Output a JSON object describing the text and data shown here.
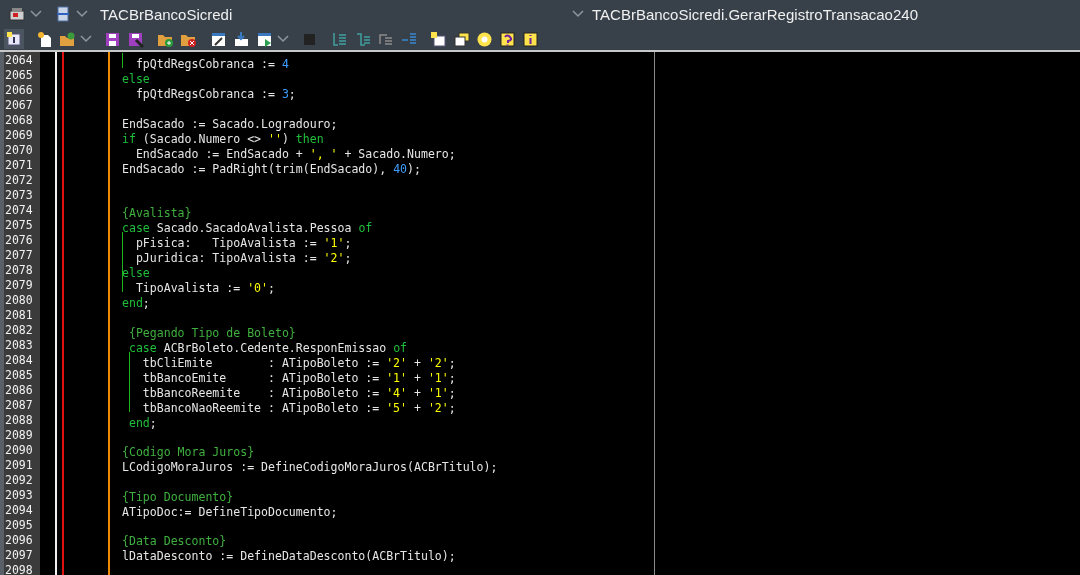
{
  "title_bar": {
    "class_name": "TACBrBancoSicredi",
    "method_name": "TACBrBancoSicredi.GerarRegistroTransacao240"
  },
  "editor": {
    "lines": [
      {
        "number": "2064",
        "guide": true,
        "tokens": [
          {
            "kind": "plain",
            "text": "  fpQtdRegsCobranca := "
          },
          {
            "kind": "number",
            "text": "4"
          }
        ]
      },
      {
        "number": "2065",
        "guide": false,
        "tokens": [
          {
            "kind": "keyword",
            "text": "else"
          }
        ]
      },
      {
        "number": "2066",
        "guide": false,
        "tokens": [
          {
            "kind": "plain",
            "text": "  fpQtdRegsCobranca := "
          },
          {
            "kind": "number",
            "text": "3"
          },
          {
            "kind": "plain",
            "text": ";"
          }
        ]
      },
      {
        "number": "2067",
        "guide": false
      },
      {
        "number": "2068",
        "guide": false,
        "tokens": [
          {
            "kind": "plain",
            "text": "EndSacado := Sacado.Logradouro;"
          }
        ]
      },
      {
        "number": "2069",
        "guide": false,
        "tokens": [
          {
            "kind": "keyword",
            "text": "if"
          },
          {
            "kind": "plain",
            "text": " (Sacado.Numero <> "
          },
          {
            "kind": "string",
            "text": "''"
          },
          {
            "kind": "plain",
            "text": ") "
          },
          {
            "kind": "keyword",
            "text": "then"
          }
        ]
      },
      {
        "number": "2070",
        "guide": false,
        "tokens": [
          {
            "kind": "plain",
            "text": "  EndSacado := EndSacado + "
          },
          {
            "kind": "string",
            "text": "', '"
          },
          {
            "kind": "plain",
            "text": " + Sacado.Numero;"
          }
        ]
      },
      {
        "number": "2071",
        "guide": false,
        "tokens": [
          {
            "kind": "plain",
            "text": "EndSacado := PadRight(trim(EndSacado), "
          },
          {
            "kind": "number",
            "text": "40"
          },
          {
            "kind": "plain",
            "text": ");"
          }
        ]
      },
      {
        "number": "2072",
        "guide": false
      },
      {
        "number": "2073",
        "guide": false
      },
      {
        "number": "2074",
        "guide": false,
        "tokens": [
          {
            "kind": "comment",
            "text": "{Avalista}"
          }
        ]
      },
      {
        "number": "2075",
        "guide": false,
        "tokens": [
          {
            "kind": "keyword",
            "text": "case"
          },
          {
            "kind": "plain",
            "text": " Sacado.SacadoAvalista.Pessoa "
          },
          {
            "kind": "keyword",
            "text": "of"
          }
        ]
      },
      {
        "number": "2076",
        "guide": true,
        "tokens": [
          {
            "kind": "plain",
            "text": "  pFisica:   TipoAvalista := "
          },
          {
            "kind": "string",
            "text": "'1'"
          },
          {
            "kind": "plain",
            "text": ";"
          }
        ]
      },
      {
        "number": "2077",
        "guide": true,
        "tokens": [
          {
            "kind": "plain",
            "text": "  pJuridica: TipoAvalista := "
          },
          {
            "kind": "string",
            "text": "'2'"
          },
          {
            "kind": "plain",
            "text": ";"
          }
        ]
      },
      {
        "number": "2078",
        "guide": true,
        "tokens": [
          {
            "kind": "keyword",
            "text": "else"
          }
        ]
      },
      {
        "number": "2079",
        "guide": true,
        "tokens": [
          {
            "kind": "plain",
            "text": "  TipoAvalista := "
          },
          {
            "kind": "string",
            "text": "'0'"
          },
          {
            "kind": "plain",
            "text": ";"
          }
        ]
      },
      {
        "number": "2080",
        "guide": false,
        "tokens": [
          {
            "kind": "keyword",
            "text": "end"
          },
          {
            "kind": "plain",
            "text": ";"
          }
        ]
      },
      {
        "number": "2081",
        "guide": false
      },
      {
        "number": "2082",
        "guide": false,
        "tokens": [
          {
            "kind": "comment",
            "text": " {Pegando Tipo de Boleto}"
          }
        ]
      },
      {
        "number": "2083",
        "guide": false,
        "tokens": [
          {
            "kind": "keyword",
            "text": " case"
          },
          {
            "kind": "plain",
            "text": " ACBrBoleto.Cedente.ResponEmissao "
          },
          {
            "kind": "keyword",
            "text": "of"
          }
        ]
      },
      {
        "number": "2084",
        "guide": true,
        "tokens": [
          {
            "kind": "plain",
            "text": "   tbCliEmite        : ATipoBoleto := "
          },
          {
            "kind": "string",
            "text": "'2'"
          },
          {
            "kind": "plain",
            "text": " + "
          },
          {
            "kind": "string",
            "text": "'2'"
          },
          {
            "kind": "plain",
            "text": ";"
          }
        ]
      },
      {
        "number": "2085",
        "guide": true,
        "tokens": [
          {
            "kind": "plain",
            "text": "   tbBancoEmite      : ATipoBoleto := "
          },
          {
            "kind": "string",
            "text": "'1'"
          },
          {
            "kind": "plain",
            "text": " + "
          },
          {
            "kind": "string",
            "text": "'1'"
          },
          {
            "kind": "plain",
            "text": ";"
          }
        ]
      },
      {
        "number": "2086",
        "guide": true,
        "tokens": [
          {
            "kind": "plain",
            "text": "   tbBancoReemite    : ATipoBoleto := "
          },
          {
            "kind": "string",
            "text": "'4'"
          },
          {
            "kind": "plain",
            "text": " + "
          },
          {
            "kind": "string",
            "text": "'1'"
          },
          {
            "kind": "plain",
            "text": ";"
          }
        ]
      },
      {
        "number": "2087",
        "guide": true,
        "tokens": [
          {
            "kind": "plain",
            "text": "   tbBancoNaoReemite : ATipoBoleto := "
          },
          {
            "kind": "string",
            "text": "'5'"
          },
          {
            "kind": "plain",
            "text": " + "
          },
          {
            "kind": "string",
            "text": "'2'"
          },
          {
            "kind": "plain",
            "text": ";"
          }
        ]
      },
      {
        "number": "2088",
        "guide": false,
        "tokens": [
          {
            "kind": "keyword",
            "text": " end"
          },
          {
            "kind": "plain",
            "text": ";"
          }
        ]
      },
      {
        "number": "2089",
        "guide": false
      },
      {
        "number": "2090",
        "guide": false,
        "tokens": [
          {
            "kind": "comment",
            "text": "{Codigo Mora Juros}"
          }
        ]
      },
      {
        "number": "2091",
        "guide": false,
        "tokens": [
          {
            "kind": "plain",
            "text": "LCodigoMoraJuros := DefineCodigoMoraJuros(ACBrTitulo);"
          }
        ]
      },
      {
        "number": "2092",
        "guide": false
      },
      {
        "number": "2093",
        "guide": false,
        "tokens": [
          {
            "kind": "comment",
            "text": "{Tipo Documento}"
          }
        ]
      },
      {
        "number": "2094",
        "guide": false,
        "tokens": [
          {
            "kind": "plain",
            "text": "ATipoDoc:= DefineTipoDocumento;"
          }
        ]
      },
      {
        "number": "2095",
        "guide": false
      },
      {
        "number": "2096",
        "guide": false,
        "tokens": [
          {
            "kind": "comment",
            "text": "{Data Desconto}"
          }
        ]
      },
      {
        "number": "2097",
        "guide": false,
        "tokens": [
          {
            "kind": "plain",
            "text": "lDataDesconto := DefineDataDesconto(ACBrTitulo);"
          }
        ]
      },
      {
        "number": "2098",
        "guide": false
      }
    ]
  }
}
